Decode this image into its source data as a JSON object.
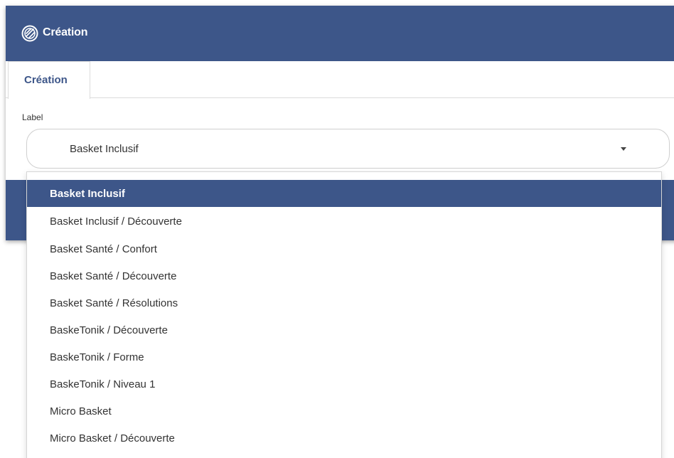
{
  "header": {
    "title": "Création",
    "logo_icon": "basketball-icon",
    "background_color": "#3d5689"
  },
  "tabs": [
    {
      "label": "Création",
      "active": true
    }
  ],
  "form": {
    "label_field": {
      "label": "Label",
      "selected_value": "Basket Inclusif"
    }
  },
  "dropdown": {
    "options": [
      {
        "label": "Basket Inclusif",
        "selected": true
      },
      {
        "label": "Basket Inclusif / Découverte",
        "selected": false
      },
      {
        "label": "Basket Santé / Confort",
        "selected": false
      },
      {
        "label": "Basket Santé / Découverte",
        "selected": false
      },
      {
        "label": "Basket Santé / Résolutions",
        "selected": false
      },
      {
        "label": "BaskeTonik / Découverte",
        "selected": false
      },
      {
        "label": "BaskeTonik / Forme",
        "selected": false
      },
      {
        "label": "BaskeTonik / Niveau 1",
        "selected": false
      },
      {
        "label": "Micro Basket",
        "selected": false
      },
      {
        "label": "Micro Basket / Découverte",
        "selected": false
      }
    ]
  },
  "colors": {
    "accent": "#3d5689",
    "text": "#333333"
  }
}
